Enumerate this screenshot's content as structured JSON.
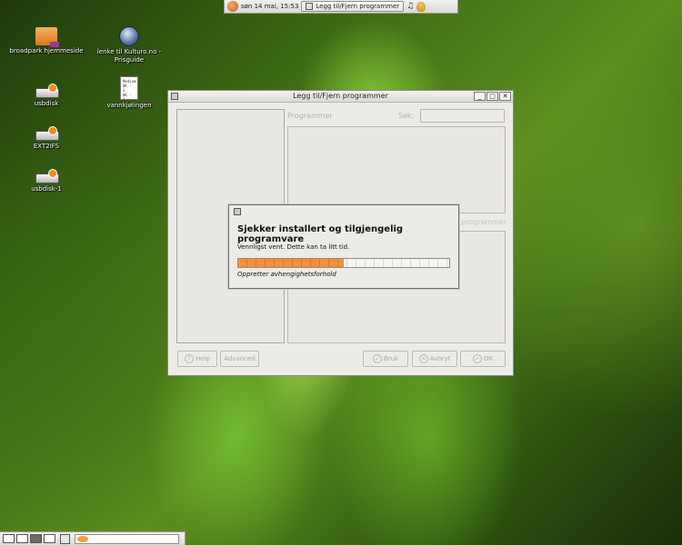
{
  "top_panel": {
    "clock": "søn 14 mai, 15:53",
    "task_button": "Legg til/Fjern programmer"
  },
  "desktop_icons": [
    {
      "label": "broadpark hjemmeside",
      "icon": "folder-icon"
    },
    {
      "label": "lenke til Kulturo.no - Prisguide",
      "icon": "globe-icon"
    },
    {
      "label": "usbdisk",
      "icon": "drive-icon"
    },
    {
      "label": "vannkjølingen",
      "icon": "document-icon",
      "doc_lines": [
        "Medium",
        "0K - 1",
        "0K - 1"
      ]
    },
    {
      "label": "EXT2IFS",
      "icon": "drive-icon"
    },
    {
      "label": "usbdisk-1",
      "icon": "drive-icon"
    }
  ],
  "main_window": {
    "title": "Legg til/Fjern programmer",
    "programs_label": "Programmer",
    "search_label": "Søk:",
    "search_value": "",
    "description_label": "programmer",
    "buttons": {
      "help": "Help",
      "advanced": "Advanced",
      "apply": "Bruk",
      "cancel": "Avbryt",
      "ok": "OK"
    }
  },
  "progress_dialog": {
    "heading": "Sjekker installert og tilgjengelig programvare",
    "message": "Vennligst vent. Dette kan ta litt tid.",
    "status": "Oppretter avhengighetsforhold",
    "progress": 0.5
  },
  "colors": {
    "progress_fill": "#f28a2e",
    "window_bg": "#edebe7"
  }
}
